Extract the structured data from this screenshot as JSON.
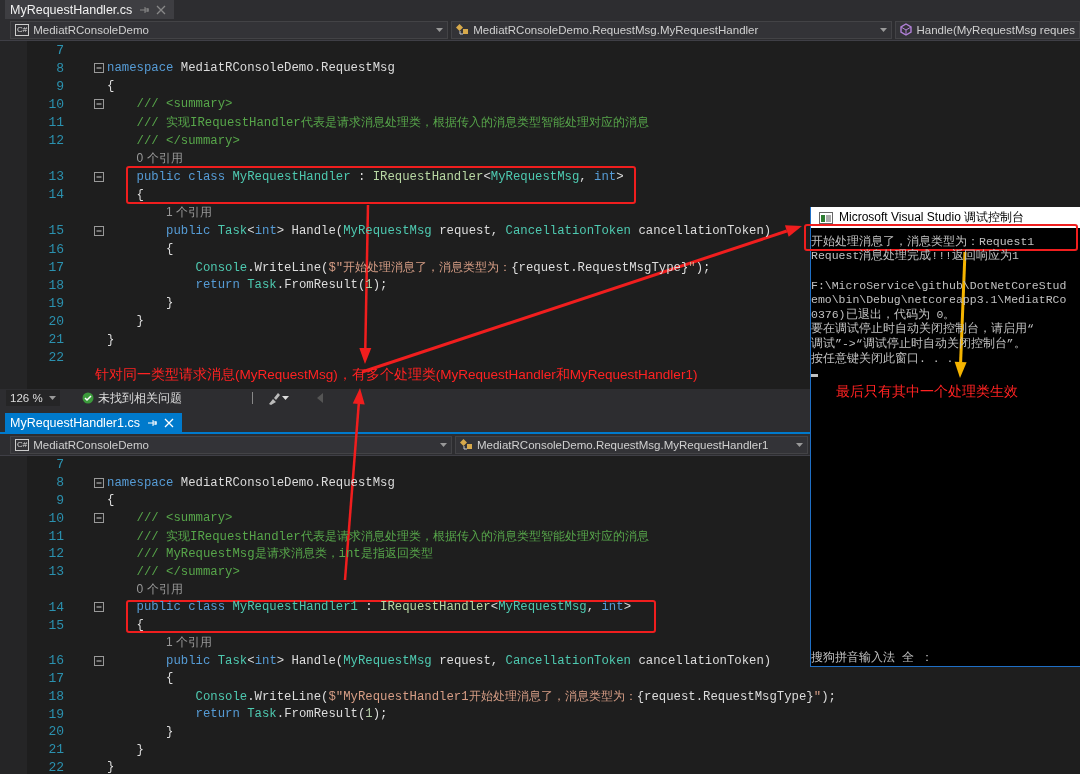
{
  "editors": [
    {
      "tab": {
        "label": "MyRequestHandler.cs",
        "selected": false
      },
      "nav": {
        "language_badge": "C#",
        "project": "MediatRConsoleDemo",
        "type": "MediatRConsoleDemo.RequestMsg.MyRequestHandler",
        "member": "Handle(MyRequestMsg reques"
      },
      "lines": [
        {
          "kind": "code",
          "number": "7"
        },
        {
          "kind": "code",
          "number": "8",
          "fold": true,
          "tokens": [
            {
              "kind": "keyword",
              "text": "namespace"
            },
            {
              "kind": "plain",
              "text": " MediatRConsoleDemo.RequestMsg"
            }
          ]
        },
        {
          "kind": "code",
          "number": "9",
          "tokens": [
            {
              "kind": "plain",
              "text": "{"
            }
          ]
        },
        {
          "kind": "code",
          "number": "10",
          "fold": true,
          "tokens": [
            {
              "kind": "comment",
              "text": "    /// <summary>"
            }
          ]
        },
        {
          "kind": "code",
          "number": "11",
          "tokens": [
            {
              "kind": "comment",
              "text": "    /// 实现IRequestHandler代表是请求消息处理类，根据传入的消息类型智能处理对应的消息"
            }
          ]
        },
        {
          "kind": "code",
          "number": "12",
          "tokens": [
            {
              "kind": "comment",
              "text": "    /// </summary>"
            }
          ]
        },
        {
          "kind": "codelens",
          "text": "    0 个引用"
        },
        {
          "kind": "code",
          "number": "13",
          "fold": true,
          "tokens": [
            {
              "kind": "keyword",
              "text": "    public class "
            },
            {
              "kind": "type",
              "text": "MyRequestHandler"
            },
            {
              "kind": "plain",
              "text": " : "
            },
            {
              "kind": "interface",
              "text": "IRequestHandler"
            },
            {
              "kind": "plain",
              "text": "<"
            },
            {
              "kind": "type",
              "text": "MyRequestMsg"
            },
            {
              "kind": "plain",
              "text": ", "
            },
            {
              "kind": "keyword",
              "text": "int"
            },
            {
              "kind": "plain",
              "text": ">"
            }
          ]
        },
        {
          "kind": "code",
          "number": "14",
          "tokens": [
            {
              "kind": "plain",
              "text": "    {"
            }
          ]
        },
        {
          "kind": "codelens",
          "text": "        1 个引用"
        },
        {
          "kind": "code",
          "number": "15",
          "fold": true,
          "tokens": [
            {
              "kind": "keyword",
              "text": "        public "
            },
            {
              "kind": "type",
              "text": "Task"
            },
            {
              "kind": "plain",
              "text": "<"
            },
            {
              "kind": "keyword",
              "text": "int"
            },
            {
              "kind": "plain",
              "text": "> Handle("
            },
            {
              "kind": "type",
              "text": "MyRequestMsg"
            },
            {
              "kind": "plain",
              "text": " request, "
            },
            {
              "kind": "type",
              "text": "CancellationToken"
            },
            {
              "kind": "plain",
              "text": " cancellationToken)"
            }
          ]
        },
        {
          "kind": "code",
          "number": "16",
          "tokens": [
            {
              "kind": "plain",
              "text": "        {"
            }
          ]
        },
        {
          "kind": "code",
          "number": "17",
          "tokens": [
            {
              "kind": "type",
              "text": "            Console"
            },
            {
              "kind": "plain",
              "text": ".WriteLine("
            },
            {
              "kind": "string",
              "text": "$\"开始处理消息了，消息类型为："
            },
            {
              "kind": "plain",
              "text": "{request.RequestMsgType}"
            },
            {
              "kind": "string",
              "text": "\""
            },
            {
              "kind": "plain",
              "text": ");"
            }
          ]
        },
        {
          "kind": "code",
          "number": "18",
          "tokens": [
            {
              "kind": "keyword",
              "text": "            return "
            },
            {
              "kind": "type",
              "text": "Task"
            },
            {
              "kind": "plain",
              "text": ".FromResult("
            },
            {
              "kind": "number",
              "text": "1"
            },
            {
              "kind": "plain",
              "text": ");"
            }
          ]
        },
        {
          "kind": "code",
          "number": "19",
          "tokens": [
            {
              "kind": "plain",
              "text": "        }"
            }
          ]
        },
        {
          "kind": "code",
          "number": "20",
          "tokens": [
            {
              "kind": "plain",
              "text": "    }"
            }
          ]
        },
        {
          "kind": "code",
          "number": "21",
          "tokens": [
            {
              "kind": "plain",
              "text": "}"
            }
          ]
        },
        {
          "kind": "code",
          "number": "22"
        }
      ],
      "status_bar": {
        "zoom": "126 %",
        "issues": "未找到相关问题"
      }
    },
    {
      "tab": {
        "label": "MyRequestHandler1.cs",
        "selected": true
      },
      "nav": {
        "language_badge": "C#",
        "project": "MediatRConsoleDemo",
        "type": "MediatRConsoleDemo.RequestMsg.MyRequestHandler1"
      },
      "lines": [
        {
          "kind": "code",
          "number": "7"
        },
        {
          "kind": "code",
          "number": "8",
          "fold": true,
          "tokens": [
            {
              "kind": "keyword",
              "text": "namespace"
            },
            {
              "kind": "plain",
              "text": " MediatRConsoleDemo.RequestMsg"
            }
          ]
        },
        {
          "kind": "code",
          "number": "9",
          "tokens": [
            {
              "kind": "plain",
              "text": "{"
            }
          ]
        },
        {
          "kind": "code",
          "number": "10",
          "fold": true,
          "tokens": [
            {
              "kind": "comment",
              "text": "    /// <summary>"
            }
          ]
        },
        {
          "kind": "code",
          "number": "11",
          "tokens": [
            {
              "kind": "comment",
              "text": "    /// 实现IRequestHandler代表是请求消息处理类，根据传入的消息类型智能处理对应的消息"
            }
          ]
        },
        {
          "kind": "code",
          "number": "12",
          "tokens": [
            {
              "kind": "comment",
              "text": "    /// MyRequestMsg是请求消息类，int是指返回类型"
            }
          ]
        },
        {
          "kind": "code",
          "number": "13",
          "tokens": [
            {
              "kind": "comment",
              "text": "    /// </summary>"
            }
          ]
        },
        {
          "kind": "codelens",
          "text": "    0 个引用"
        },
        {
          "kind": "code",
          "number": "14",
          "fold": true,
          "tokens": [
            {
              "kind": "keyword",
              "text": "    public class "
            },
            {
              "kind": "type",
              "text": "MyRequestHandler1"
            },
            {
              "kind": "plain",
              "text": " : "
            },
            {
              "kind": "interface",
              "text": "IRequestHandler"
            },
            {
              "kind": "plain",
              "text": "<"
            },
            {
              "kind": "type",
              "text": "MyRequestMsg"
            },
            {
              "kind": "plain",
              "text": ", "
            },
            {
              "kind": "keyword",
              "text": "int"
            },
            {
              "kind": "plain",
              "text": ">"
            }
          ]
        },
        {
          "kind": "code",
          "number": "15",
          "tokens": [
            {
              "kind": "plain",
              "text": "    {"
            }
          ]
        },
        {
          "kind": "codelens",
          "text": "        1 个引用"
        },
        {
          "kind": "code",
          "number": "16",
          "fold": true,
          "tokens": [
            {
              "kind": "keyword",
              "text": "        public "
            },
            {
              "kind": "type",
              "text": "Task"
            },
            {
              "kind": "plain",
              "text": "<"
            },
            {
              "kind": "keyword",
              "text": "int"
            },
            {
              "kind": "plain",
              "text": "> Handle("
            },
            {
              "kind": "type",
              "text": "MyRequestMsg"
            },
            {
              "kind": "plain",
              "text": " request, "
            },
            {
              "kind": "type",
              "text": "CancellationToken"
            },
            {
              "kind": "plain",
              "text": " cancellationToken)"
            }
          ]
        },
        {
          "kind": "code",
          "number": "17",
          "tokens": [
            {
              "kind": "plain",
              "text": "        {"
            }
          ]
        },
        {
          "kind": "code",
          "number": "18",
          "tokens": [
            {
              "kind": "type",
              "text": "            Console"
            },
            {
              "kind": "plain",
              "text": ".WriteLine("
            },
            {
              "kind": "string",
              "text": "$\"MyRequestHandler1开始处理消息了，消息类型为："
            },
            {
              "kind": "plain",
              "text": "{request.RequestMsgType}"
            },
            {
              "kind": "string",
              "text": "\""
            },
            {
              "kind": "plain",
              "text": ");"
            }
          ]
        },
        {
          "kind": "code",
          "number": "19",
          "tokens": [
            {
              "kind": "keyword",
              "text": "            return "
            },
            {
              "kind": "type",
              "text": "Task"
            },
            {
              "kind": "plain",
              "text": ".FromResult("
            },
            {
              "kind": "number",
              "text": "1"
            },
            {
              "kind": "plain",
              "text": ");"
            }
          ]
        },
        {
          "kind": "code",
          "number": "20",
          "tokens": [
            {
              "kind": "plain",
              "text": "        }"
            }
          ]
        },
        {
          "kind": "code",
          "number": "21",
          "tokens": [
            {
              "kind": "plain",
              "text": "    }"
            }
          ]
        },
        {
          "kind": "code",
          "number": "22",
          "tokens": [
            {
              "kind": "plain",
              "text": "}"
            }
          ]
        }
      ]
    }
  ],
  "console": {
    "title": "Microsoft Visual Studio 调试控制台",
    "lines": [
      {
        "kind": "text",
        "text": "开始处理消息了，消息类型为：Request1"
      },
      {
        "kind": "text",
        "text": "Request消息处理完成!!!返回响应为1"
      },
      {
        "kind": "blank"
      },
      {
        "kind": "text",
        "text": "F:\\MicroService\\github\\DotNetCoreStud"
      },
      {
        "kind": "text",
        "text": "emo\\bin\\Debug\\netcoreapp3.1\\MediatRCo"
      },
      {
        "kind": "text",
        "text": "0376)已退出，代码为 0。"
      },
      {
        "kind": "text",
        "text": "要在调试停止时自动关闭控制台，请启用“"
      },
      {
        "kind": "text",
        "text": "调试”->“调试停止时自动关闭控制台”。"
      },
      {
        "kind": "text",
        "text": "按任意键关闭此窗口. . ."
      },
      {
        "kind": "cursor"
      }
    ],
    "ime_status": "搜狗拼音输入法 全 ："
  },
  "annotations": {
    "caption": "针对同一类型请求消息(MyRequestMsg)，有多个处理类(MyRequestHandler和MyRequestHandler1)",
    "console_note": "最后只有其中一个处理类生效"
  }
}
